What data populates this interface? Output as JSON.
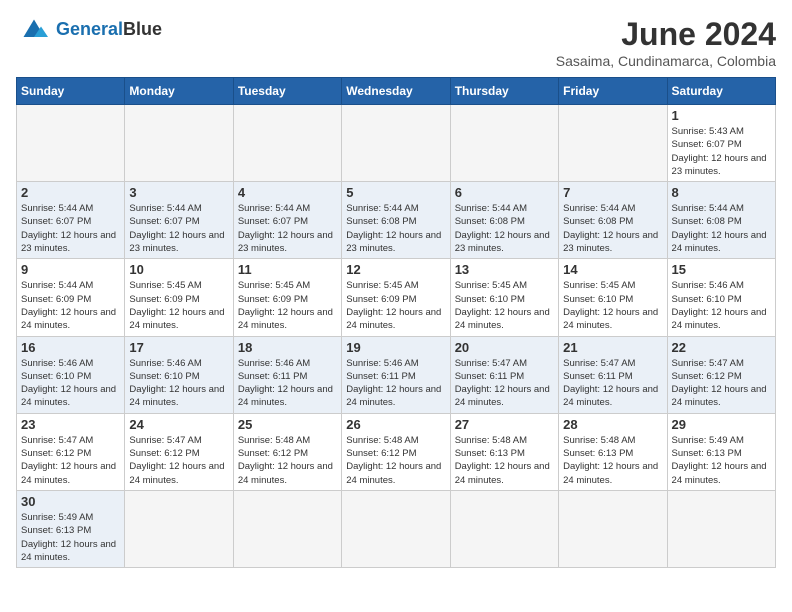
{
  "header": {
    "logo_general": "General",
    "logo_blue": "Blue",
    "month_title": "June 2024",
    "location": "Sasaima, Cundinamarca, Colombia"
  },
  "days_of_week": [
    "Sunday",
    "Monday",
    "Tuesday",
    "Wednesday",
    "Thursday",
    "Friday",
    "Saturday"
  ],
  "weeks": [
    {
      "days": [
        {
          "num": "",
          "empty": true
        },
        {
          "num": "",
          "empty": true
        },
        {
          "num": "",
          "empty": true
        },
        {
          "num": "",
          "empty": true
        },
        {
          "num": "",
          "empty": true
        },
        {
          "num": "",
          "empty": true
        },
        {
          "num": "1",
          "sunrise": "5:43 AM",
          "sunset": "6:07 PM",
          "daylight": "12 hours and 23 minutes."
        }
      ]
    },
    {
      "days": [
        {
          "num": "2",
          "sunrise": "5:44 AM",
          "sunset": "6:07 PM",
          "daylight": "12 hours and 23 minutes."
        },
        {
          "num": "3",
          "sunrise": "5:44 AM",
          "sunset": "6:07 PM",
          "daylight": "12 hours and 23 minutes."
        },
        {
          "num": "4",
          "sunrise": "5:44 AM",
          "sunset": "6:07 PM",
          "daylight": "12 hours and 23 minutes."
        },
        {
          "num": "5",
          "sunrise": "5:44 AM",
          "sunset": "6:08 PM",
          "daylight": "12 hours and 23 minutes."
        },
        {
          "num": "6",
          "sunrise": "5:44 AM",
          "sunset": "6:08 PM",
          "daylight": "12 hours and 23 minutes."
        },
        {
          "num": "7",
          "sunrise": "5:44 AM",
          "sunset": "6:08 PM",
          "daylight": "12 hours and 23 minutes."
        },
        {
          "num": "8",
          "sunrise": "5:44 AM",
          "sunset": "6:08 PM",
          "daylight": "12 hours and 24 minutes."
        }
      ]
    },
    {
      "days": [
        {
          "num": "9",
          "sunrise": "5:44 AM",
          "sunset": "6:09 PM",
          "daylight": "12 hours and 24 minutes."
        },
        {
          "num": "10",
          "sunrise": "5:45 AM",
          "sunset": "6:09 PM",
          "daylight": "12 hours and 24 minutes."
        },
        {
          "num": "11",
          "sunrise": "5:45 AM",
          "sunset": "6:09 PM",
          "daylight": "12 hours and 24 minutes."
        },
        {
          "num": "12",
          "sunrise": "5:45 AM",
          "sunset": "6:09 PM",
          "daylight": "12 hours and 24 minutes."
        },
        {
          "num": "13",
          "sunrise": "5:45 AM",
          "sunset": "6:10 PM",
          "daylight": "12 hours and 24 minutes."
        },
        {
          "num": "14",
          "sunrise": "5:45 AM",
          "sunset": "6:10 PM",
          "daylight": "12 hours and 24 minutes."
        },
        {
          "num": "15",
          "sunrise": "5:46 AM",
          "sunset": "6:10 PM",
          "daylight": "12 hours and 24 minutes."
        }
      ]
    },
    {
      "days": [
        {
          "num": "16",
          "sunrise": "5:46 AM",
          "sunset": "6:10 PM",
          "daylight": "12 hours and 24 minutes."
        },
        {
          "num": "17",
          "sunrise": "5:46 AM",
          "sunset": "6:10 PM",
          "daylight": "12 hours and 24 minutes."
        },
        {
          "num": "18",
          "sunrise": "5:46 AM",
          "sunset": "6:11 PM",
          "daylight": "12 hours and 24 minutes."
        },
        {
          "num": "19",
          "sunrise": "5:46 AM",
          "sunset": "6:11 PM",
          "daylight": "12 hours and 24 minutes."
        },
        {
          "num": "20",
          "sunrise": "5:47 AM",
          "sunset": "6:11 PM",
          "daylight": "12 hours and 24 minutes."
        },
        {
          "num": "21",
          "sunrise": "5:47 AM",
          "sunset": "6:11 PM",
          "daylight": "12 hours and 24 minutes."
        },
        {
          "num": "22",
          "sunrise": "5:47 AM",
          "sunset": "6:12 PM",
          "daylight": "12 hours and 24 minutes."
        }
      ]
    },
    {
      "days": [
        {
          "num": "23",
          "sunrise": "5:47 AM",
          "sunset": "6:12 PM",
          "daylight": "12 hours and 24 minutes."
        },
        {
          "num": "24",
          "sunrise": "5:47 AM",
          "sunset": "6:12 PM",
          "daylight": "12 hours and 24 minutes."
        },
        {
          "num": "25",
          "sunrise": "5:48 AM",
          "sunset": "6:12 PM",
          "daylight": "12 hours and 24 minutes."
        },
        {
          "num": "26",
          "sunrise": "5:48 AM",
          "sunset": "6:12 PM",
          "daylight": "12 hours and 24 minutes."
        },
        {
          "num": "27",
          "sunrise": "5:48 AM",
          "sunset": "6:13 PM",
          "daylight": "12 hours and 24 minutes."
        },
        {
          "num": "28",
          "sunrise": "5:48 AM",
          "sunset": "6:13 PM",
          "daylight": "12 hours and 24 minutes."
        },
        {
          "num": "29",
          "sunrise": "5:49 AM",
          "sunset": "6:13 PM",
          "daylight": "12 hours and 24 minutes."
        }
      ]
    },
    {
      "days": [
        {
          "num": "30",
          "sunrise": "5:49 AM",
          "sunset": "6:13 PM",
          "daylight": "12 hours and 24 minutes."
        },
        {
          "num": "",
          "empty": true
        },
        {
          "num": "",
          "empty": true
        },
        {
          "num": "",
          "empty": true
        },
        {
          "num": "",
          "empty": true
        },
        {
          "num": "",
          "empty": true
        },
        {
          "num": "",
          "empty": true
        }
      ]
    }
  ]
}
